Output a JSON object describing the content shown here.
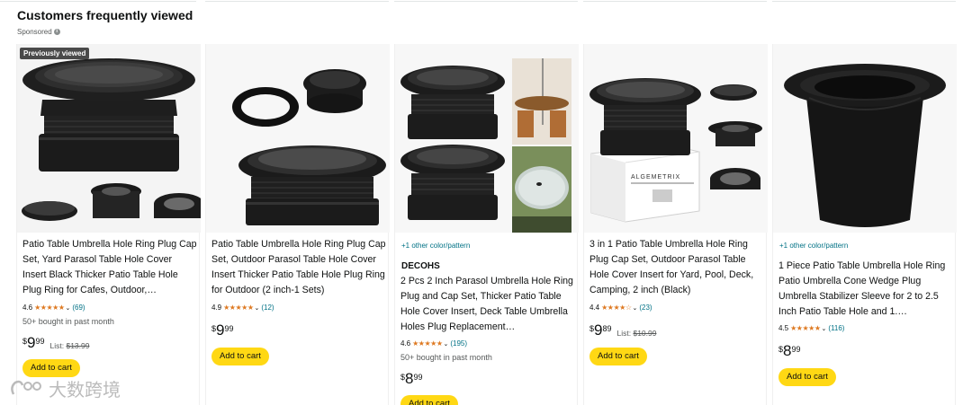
{
  "section": {
    "title": "Customers frequently viewed",
    "sponsored": "Sponsored",
    "info_icon": "info-icon"
  },
  "colors": {
    "add_to_cart_bg": "#ffd814",
    "link": "#007185",
    "star": "#de7921",
    "badge_bg": "#4a4a4a"
  },
  "products": [
    {
      "badge": "Previously viewed",
      "title": "Patio Table Umbrella Hole Ring Plug Cap Set, Yard Parasol Table Hole Cover Insert Black Thicker Patio Table Hole Plug Ring for Cafes, Outdoor,…",
      "rating": "4.6",
      "stars": 4.6,
      "reviews": "(69)",
      "bought": "50+ bought in past month",
      "price": {
        "currency": "$",
        "whole": "9",
        "fraction": "99",
        "list_label": "List:",
        "list_price": "$13.99"
      },
      "add_to_cart": "Add to cart"
    },
    {
      "title": "Patio Table Umbrella Hole Ring Plug Cap Set, Outdoor Parasol Table Hole Cover Insert Thicker Patio Table Hole Plug Ring for Outdoor (2 inch-1 Sets)",
      "rating": "4.9",
      "stars": 4.9,
      "reviews": "(12)",
      "price": {
        "currency": "$",
        "whole": "9",
        "fraction": "99"
      },
      "add_to_cart": "Add to cart"
    },
    {
      "color_link": "+1 other color/pattern",
      "brand": "DECOHS",
      "title": "2 Pcs 2 Inch Parasol Umbrella Hole Ring Plug and Cap Set, Thicker Patio Table Hole Cover Insert, Deck Table Umbrella Holes Plug Replacement…",
      "rating": "4.6",
      "stars": 4.6,
      "reviews": "(195)",
      "bought": "50+ bought in past month",
      "price": {
        "currency": "$",
        "whole": "8",
        "fraction": "99"
      },
      "add_to_cart": "Add to cart"
    },
    {
      "title": "3 in 1 Patio Table Umbrella Hole Ring Plug Cap Set, Outdoor Parasol Table Hole Cover Insert for Yard, Pool, Deck, Camping, 2 inch (Black)",
      "box_brand": "ALGEMETRIX",
      "rating": "4.4",
      "stars": 4.4,
      "reviews": "(23)",
      "price": {
        "currency": "$",
        "whole": "9",
        "fraction": "89",
        "list_label": "List:",
        "list_price": "$10.99"
      },
      "add_to_cart": "Add to cart"
    },
    {
      "color_link": "+1 other color/pattern",
      "title": "1 Piece Patio Table Umbrella Hole Ring Patio Umbrella Cone Wedge Plug Umbrella Stabilizer Sleeve for 2 to 2.5 Inch Patio Table Hole and 1.…",
      "rating": "4.5",
      "stars": 4.5,
      "reviews": "(116)",
      "price": {
        "currency": "$",
        "whole": "8",
        "fraction": "99"
      },
      "add_to_cart": "Add to cart"
    }
  ],
  "watermark": "大数跨境"
}
